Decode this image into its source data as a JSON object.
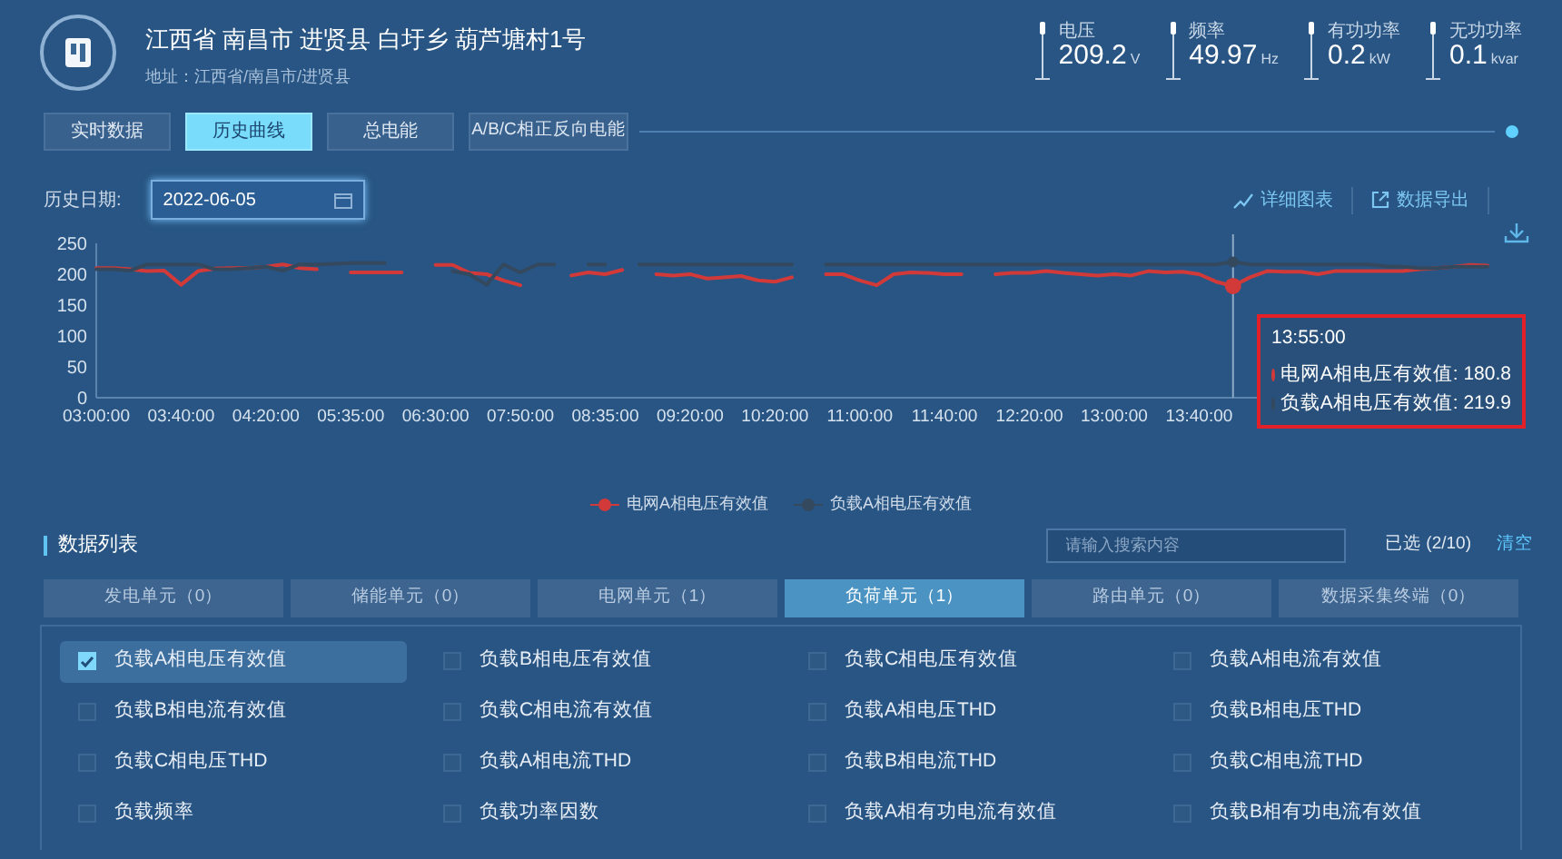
{
  "station": {
    "title": "江西省 南昌市 进贤县 白圩乡 葫芦塘村1号",
    "address": "地址：江西省/南昌市/进贤县"
  },
  "metrics": [
    {
      "label": "电压",
      "value": "209.2",
      "unit": "V"
    },
    {
      "label": "频率",
      "value": "49.97",
      "unit": "Hz"
    },
    {
      "label": "有功功率",
      "value": "0.2",
      "unit": "kW"
    },
    {
      "label": "无功功率",
      "value": "0.1",
      "unit": "kvar"
    }
  ],
  "tabs": [
    {
      "label": "实时数据",
      "selected": false
    },
    {
      "label": "历史曲线",
      "selected": true
    },
    {
      "label": "总电能",
      "selected": false
    },
    {
      "label": "A/B/C相正反向电能",
      "selected": false
    }
  ],
  "date_filter": {
    "label": "历史日期:",
    "value": "2022-06-05"
  },
  "actions": [
    "详细图表",
    "数据导出"
  ],
  "chart_data": {
    "type": "line",
    "ylim": [
      0,
      250
    ],
    "yticks": [
      0,
      50,
      100,
      150,
      200,
      250
    ],
    "categories": [
      "03:00:00",
      null,
      null,
      null,
      null,
      "03:40:00",
      null,
      null,
      null,
      null,
      "04:20:00",
      null,
      null,
      null,
      null,
      "05:35:00",
      null,
      null,
      null,
      null,
      "06:30:00",
      null,
      null,
      null,
      null,
      "07:50:00",
      null,
      null,
      null,
      null,
      "08:35:00",
      null,
      null,
      null,
      null,
      "09:20:00",
      null,
      null,
      null,
      null,
      "10:20:00",
      null,
      null,
      null,
      null,
      "11:00:00",
      null,
      null,
      null,
      null,
      "11:40:00",
      null,
      null,
      null,
      null,
      "12:20:00",
      null,
      null,
      null,
      null,
      "13:00:00",
      null,
      null,
      null,
      null,
      "13:40:00",
      null,
      null,
      null,
      null,
      null,
      null,
      null,
      null,
      null,
      null,
      null,
      null,
      null,
      null,
      null,
      null,
      null
    ],
    "series": [
      {
        "name": "电网A相电压有效值",
        "color": "#d23a3a",
        "values": [
          210,
          210,
          208,
          205,
          206,
          183,
          205,
          209,
          210,
          210,
          212,
          216,
          210,
          208,
          null,
          203,
          203,
          203,
          203,
          null,
          215,
          215,
          202,
          200,
          190,
          182,
          null,
          null,
          198,
          203,
          200,
          207,
          null,
          200,
          198,
          200,
          193,
          195,
          197,
          190,
          188,
          195,
          null,
          200,
          200,
          190,
          182,
          200,
          203,
          202,
          200,
          200,
          null,
          200,
          202,
          202,
          205,
          202,
          200,
          198,
          200,
          198,
          205,
          203,
          204,
          200,
          188,
          181,
          195,
          205,
          204,
          204,
          200,
          205,
          205,
          205,
          205,
          205,
          208,
          210,
          212,
          215,
          214
        ]
      },
      {
        "name": "负载A相电压有效值",
        "color": "#34495e",
        "values": [
          208,
          208,
          206,
          216,
          216,
          216,
          216,
          208,
          208,
          210,
          212,
          206,
          216,
          216,
          217,
          218,
          218,
          218,
          null,
          null,
          null,
          205,
          200,
          183,
          216,
          203,
          216,
          216,
          null,
          216,
          216,
          null,
          216,
          216,
          216,
          216,
          216,
          216,
          216,
          216,
          216,
          216,
          null,
          216,
          216,
          216,
          216,
          216,
          216,
          216,
          216,
          216,
          216,
          216,
          216,
          216,
          216,
          216,
          216,
          216,
          216,
          216,
          216,
          216,
          216,
          216,
          216,
          220,
          216,
          216,
          216,
          216,
          216,
          216,
          216,
          216,
          213,
          212,
          210,
          210,
          212,
          212,
          212
        ]
      }
    ],
    "annotations": [
      {
        "text": "13:55:00"
      }
    ]
  },
  "tooltip": {
    "rows": [
      "电网A相电压有效值: 180.8",
      "负载A相电压有效值: 219.9"
    ]
  },
  "data_list": {
    "title": "数据列表",
    "search": {
      "placeholder": "请输入搜索内容"
    },
    "selected_count": "已选 (2/10)",
    "clear": "清空",
    "categories": [
      {
        "label": "发电单元（0）",
        "selected": false
      },
      {
        "label": "储能单元（0）",
        "selected": false
      },
      {
        "label": "电网单元（1）",
        "selected": false
      },
      {
        "label": "负荷单元（1）",
        "selected": true
      },
      {
        "label": "路由单元（0）",
        "selected": false
      },
      {
        "label": "数据采集终端（0）",
        "selected": false
      }
    ],
    "items": [
      {
        "label": "负载A相电压有效值",
        "checked": true,
        "selected": true
      },
      {
        "label": "负载B相电压有效值",
        "checked": false,
        "selected": false
      },
      {
        "label": "负载C相电压有效值",
        "checked": false,
        "selected": false
      },
      {
        "label": "负载A相电流有效值",
        "checked": false,
        "selected": false
      },
      {
        "label": "负载B相电流有效值",
        "checked": false,
        "selected": false
      },
      {
        "label": "负载C相电流有效值",
        "checked": false,
        "selected": false
      },
      {
        "label": "负载A相电压THD",
        "checked": false,
        "selected": false
      },
      {
        "label": "负载B相电压THD",
        "checked": false,
        "selected": false
      },
      {
        "label": "负载C相电压THD",
        "checked": false,
        "selected": false
      },
      {
        "label": "负载A相电流THD",
        "checked": false,
        "selected": false
      },
      {
        "label": "负载B相电流THD",
        "checked": false,
        "selected": false
      },
      {
        "label": "负载C相电流THD",
        "checked": false,
        "selected": false
      },
      {
        "label": "负载频率",
        "checked": false,
        "selected": false
      },
      {
        "label": "负载功率因数",
        "checked": false,
        "selected": false
      },
      {
        "label": "负载A相有功电流有效值",
        "checked": false,
        "selected": false
      },
      {
        "label": "负载B相有功电流有效值",
        "checked": false,
        "selected": false
      }
    ]
  }
}
